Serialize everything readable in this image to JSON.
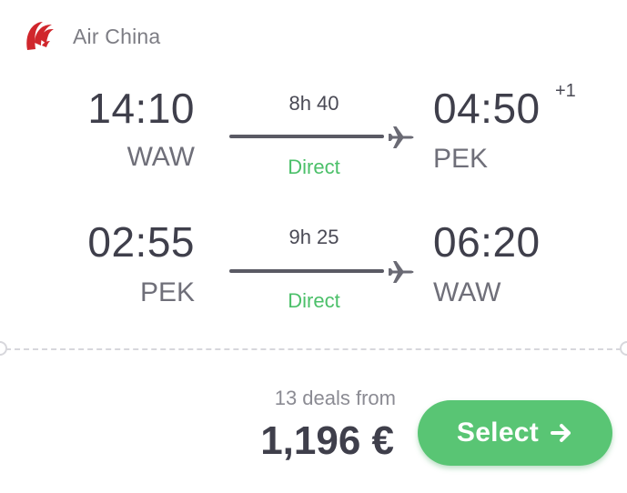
{
  "airline": {
    "name": "Air China",
    "logo_icon": "air-china-phoenix-logo",
    "logo_color": "#d0262c"
  },
  "outbound": {
    "depart_time": "14:10",
    "depart_code": "WAW",
    "duration": "8h 40",
    "stops": "Direct",
    "arrive_time": "04:50",
    "arrive_day_offset": "+1",
    "arrive_code": "PEK"
  },
  "inbound": {
    "depart_time": "02:55",
    "depart_code": "PEK",
    "duration": "9h 25",
    "stops": "Direct",
    "arrive_time": "06:20",
    "arrive_code": "WAW"
  },
  "pricing": {
    "deals_text": "13 deals from",
    "price": "1,196 €"
  },
  "actions": {
    "select_label": "Select",
    "select_icon": "arrow-right-icon"
  },
  "colors": {
    "direct_green": "#4cc06a",
    "button_green": "#59c574",
    "text_dark": "#3f3f4b"
  }
}
